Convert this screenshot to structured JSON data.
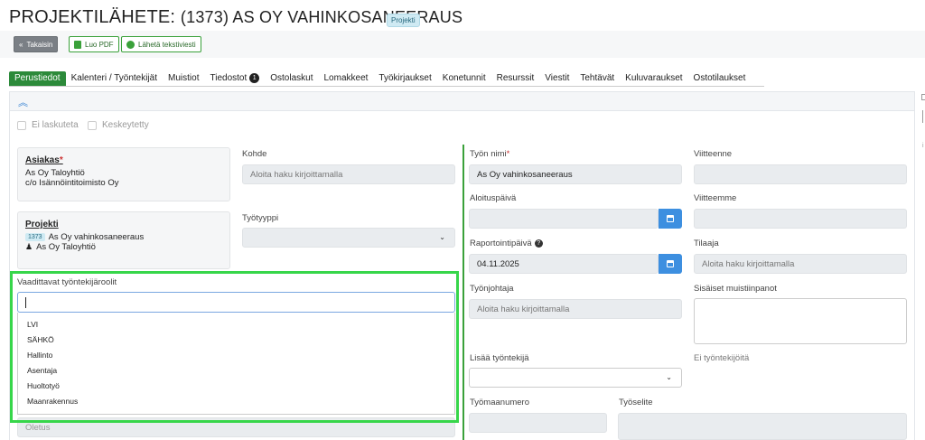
{
  "header": {
    "title": "PROJEKTILÄHETE:",
    "code_title": "(1373) AS OY VAHINKOSANEERAUS",
    "badge": "Projekti"
  },
  "toolbar": {
    "back_label": "Takaisin",
    "pdf_label": "Luo PDF",
    "sms_label": "Lähetä tekstiviesti"
  },
  "tabs": [
    {
      "label": "Perustiedot"
    },
    {
      "label": "Kalenteri / Työntekijät"
    },
    {
      "label": "Muistiot"
    },
    {
      "label": "Tiedostot",
      "count": "1"
    },
    {
      "label": "Ostolaskut"
    },
    {
      "label": "Lomakkeet"
    },
    {
      "label": "Työkirjaukset"
    },
    {
      "label": "Konetunnit"
    },
    {
      "label": "Resurssit"
    },
    {
      "label": "Viestit"
    },
    {
      "label": "Tehtävät"
    },
    {
      "label": "Kuluvaraukset"
    },
    {
      "label": "Ostotilaukset"
    }
  ],
  "checkboxes": {
    "ei_laskuteta": "Ei laskuteta",
    "keskeytetty": "Keskeytetty"
  },
  "customer_card": {
    "title": "Asiakas",
    "required_mark": "*",
    "line1": "As Oy Taloyhtiö",
    "line2": "c/o Isännöintitoimisto Oy"
  },
  "project_card": {
    "title": "Projekti",
    "code": "1373",
    "name": "As Oy vahinkosaneeraus",
    "customer": "As Oy Taloyhtiö"
  },
  "fields": {
    "kohde_label": "Kohde",
    "kohde_placeholder": "Aloita haku kirjoittamalla",
    "tyotyyppi_label": "Työtyyppi",
    "roles_label": "Vaadittavat työntekijäroolit",
    "oletus_label": "Oletus",
    "tyon_nimi_label": "Työn nimi",
    "tyon_nimi_req": "*",
    "tyon_nimi_value": "As Oy vahinkosaneeraus",
    "aloituspaiva_label": "Aloituspäivä",
    "raportointipaiva_label": "Raportointipäivä",
    "raportointipaiva_value": "04.11.2025",
    "tyonjohtaja_label": "Työnjohtaja",
    "tyonjohtaja_placeholder": "Aloita haku kirjoittamalla",
    "lisaa_tyontekija_label": "Lisää työntekijä",
    "tyomaanumero_label": "Työmaanumero",
    "tyoselite_label": "Työselite",
    "viitteenne_label": "Viitteenne",
    "viitteemme_label": "Viitteemme",
    "tilaaja_label": "Tilaaja",
    "tilaaja_placeholder": "Aloita haku kirjoittamalla",
    "sisaiset_label": "Sisäiset muistiinpanot",
    "ei_tyontekijoita": "Ei työntekijöitä"
  },
  "role_options": [
    "LVI",
    "SÄHKÖ",
    "Hallinto",
    "Asentaja",
    "Huoltotyö",
    "Maanrakennus"
  ],
  "colors": {
    "accent_green": "#2c8a3a",
    "highlight_green": "#37d64a",
    "button_blue": "#3d8fe0"
  }
}
